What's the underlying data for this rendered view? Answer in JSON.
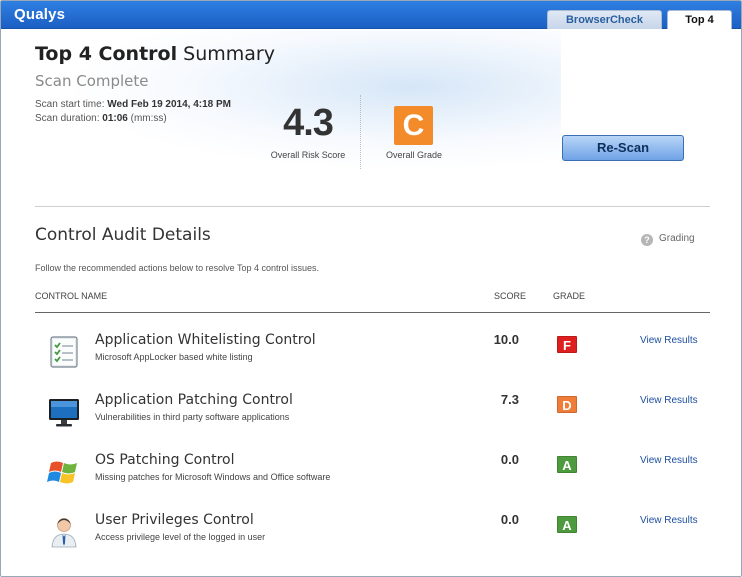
{
  "header": {
    "brand": "Qualys",
    "tabs": [
      {
        "label": "BrowserCheck",
        "active": false
      },
      {
        "label": "Top 4",
        "active": true
      }
    ]
  },
  "summary": {
    "title_bold": "Top 4 Control",
    "title_rest": " Summary",
    "status": "Scan Complete",
    "start_label": "Scan start time: ",
    "start_value": "Wed Feb 19 2014, 4:18 PM",
    "duration_label": "Scan duration: ",
    "duration_value": "01:06",
    "duration_unit": " (mm:ss)",
    "risk_score": "4.3",
    "risk_score_label": "Overall Risk Score",
    "overall_grade": "C",
    "overall_grade_label": "Overall Grade",
    "rescan_label": "Re-Scan"
  },
  "audit": {
    "title": "Control Audit Details",
    "grading_label": "Grading",
    "grading_icon": "?",
    "description": "Follow the recommended actions below to resolve Top 4 control issues.",
    "columns": {
      "name": "CONTROL NAME",
      "score": "SCORE",
      "grade": "GRADE"
    },
    "rows": [
      {
        "title": "Application Whitelisting Control",
        "subtitle": "Microsoft AppLocker based white listing",
        "score": "10.0",
        "grade": "F",
        "grade_color": "#dd1f1f",
        "link": "View Results",
        "icon": "checklist-icon"
      },
      {
        "title": "Application Patching Control",
        "subtitle": "Vulnerabilities in third party software applications",
        "score": "7.3",
        "grade": "D",
        "grade_color": "#f07c3a",
        "link": "View Results",
        "icon": "monitor-icon"
      },
      {
        "title": "OS Patching Control",
        "subtitle": "Missing patches for Microsoft Windows and Office software",
        "score": "0.0",
        "grade": "A",
        "grade_color": "#4e9a3e",
        "link": "View Results",
        "icon": "windows-logo-icon"
      },
      {
        "title": "User Privileges Control",
        "subtitle": "Access privilege level of the logged in user",
        "score": "0.0",
        "grade": "A",
        "grade_color": "#4e9a3e",
        "link": "View Results",
        "icon": "user-icon"
      }
    ]
  },
  "colors": {
    "header_blue": "#1b5fc4",
    "overall_grade_orange": "#f38b2a",
    "link_blue": "#1f4fa0"
  }
}
